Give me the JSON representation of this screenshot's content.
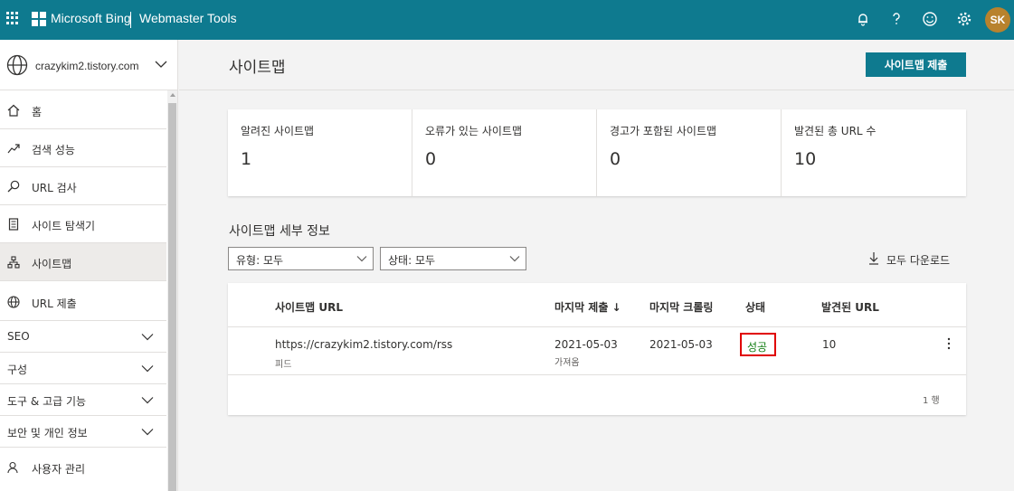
{
  "header": {
    "brand": "Microsoft Bing",
    "product": "Webmaster Tools",
    "avatar_initials": "SK",
    "icons": [
      "waffle-icon",
      "bell-icon",
      "help-icon",
      "smiley-icon",
      "gear-icon"
    ],
    "colors": {
      "bar": "#0e7a8f",
      "avatar": "#b8822d"
    }
  },
  "sidebar": {
    "site": "crazykim2.tistory.com",
    "items": [
      {
        "label": "홈",
        "icon": "home-icon"
      },
      {
        "label": "검색 성능",
        "icon": "trend-icon"
      },
      {
        "label": "URL 검사",
        "icon": "search-icon"
      },
      {
        "label": "사이트 탐색기",
        "icon": "document-icon"
      },
      {
        "label": "사이트맵",
        "icon": "sitemap-icon",
        "active": true
      },
      {
        "label": "URL 제출",
        "icon": "globe-icon"
      }
    ],
    "sections": [
      {
        "label": "SEO"
      },
      {
        "label": "구성"
      },
      {
        "label": "도구 & 고급 기능"
      },
      {
        "label": "보안 및 개인 정보"
      }
    ],
    "footer_item": {
      "label": "사용자 관리",
      "icon": "user-icon"
    }
  },
  "main": {
    "title": "사이트맵",
    "submit_button": "사이트맵 제출",
    "stats": [
      {
        "label": "알려진 사이트맵",
        "value": "1"
      },
      {
        "label": "오류가 있는 사이트맵",
        "value": "0"
      },
      {
        "label": "경고가 포함된 사이트맵",
        "value": "0"
      },
      {
        "label": "발견된 총 URL 수",
        "value": "10"
      }
    ],
    "details_title": "사이트맵 세부 정보",
    "filters": {
      "type": "유형: 모두",
      "status": "상태: 모두"
    },
    "download_all": "모두 다운로드",
    "table": {
      "columns": [
        "사이트맵 URL",
        "마지막 제출 ↓",
        "마지막 크롤링",
        "상태",
        "발견된 URL"
      ],
      "rows": [
        {
          "url": "https://crazykim2.tistory.com/rss",
          "type": "피드",
          "submitted": "2021-05-03",
          "submitted_note": "가져옴",
          "crawled": "2021-05-03",
          "status": "성공",
          "discovered": "10"
        }
      ],
      "row_count": "1 행"
    },
    "colors": {
      "success": "#107c10",
      "highlight_box": "#e00000"
    }
  }
}
